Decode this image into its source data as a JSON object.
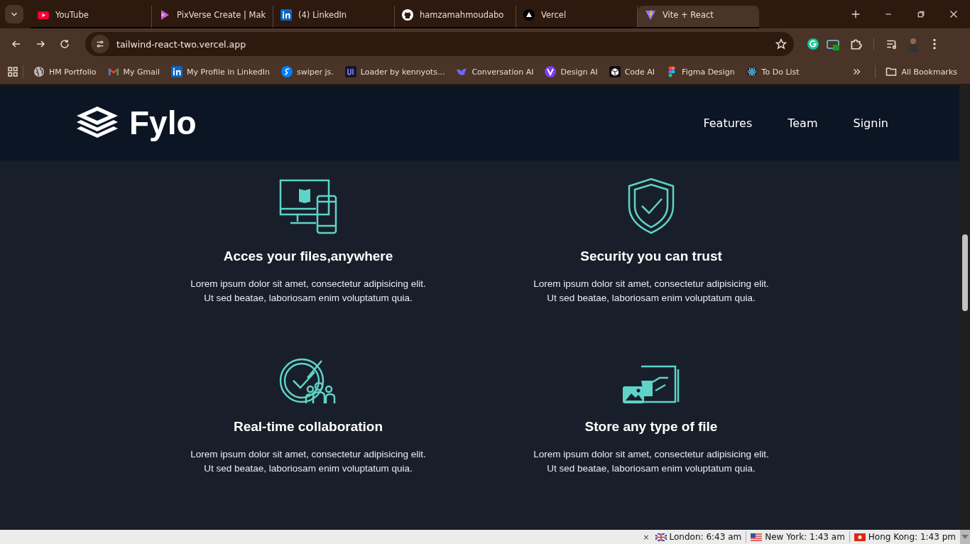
{
  "browser": {
    "tabs": [
      {
        "kind": "youtube",
        "title": "YouTube",
        "selected": false
      },
      {
        "kind": "pixverse",
        "title": "PixVerse Create | Mak",
        "selected": false
      },
      {
        "kind": "linkedin",
        "title": "(4) LinkedIn",
        "selected": false
      },
      {
        "kind": "github",
        "title": "hamzamahmoudabo",
        "selected": false
      },
      {
        "kind": "vercel",
        "title": "Vercel",
        "selected": false
      },
      {
        "kind": "vite",
        "title": "Vite + React",
        "selected": true
      }
    ],
    "address": "tailwind-react-two.vercel.app",
    "bookmarks": [
      {
        "kind": "globe",
        "label": "HM Portfolio"
      },
      {
        "kind": "gmail",
        "label": "My Gmail"
      },
      {
        "kind": "linkedin",
        "label": "My Profile in LinkedIn"
      },
      {
        "kind": "swiper",
        "label": "swiper js."
      },
      {
        "kind": "ui",
        "label": "Loader by kennyots..."
      },
      {
        "kind": "conversation",
        "label": "Conversation AI"
      },
      {
        "kind": "design",
        "label": "Design AI"
      },
      {
        "kind": "code",
        "label": "Code AI"
      },
      {
        "kind": "figma",
        "label": "Figma Design"
      },
      {
        "kind": "react",
        "label": "To Do List"
      }
    ],
    "all_bookmarks": "All Bookmarks"
  },
  "page": {
    "brand": "Fylo",
    "nav": [
      "Features",
      "Team",
      "Signin"
    ],
    "features": [
      {
        "kind": "devices",
        "title": "Acces your files,anywhere",
        "lines": [
          "Lorem ipsum dolor sit amet, consectetur adipisicing elit.",
          "Ut sed beatae, laboriosam enim voluptatum quia."
        ]
      },
      {
        "kind": "shield",
        "title": "Security you can trust",
        "lines": [
          "Lorem ipsum dolor sit amet, consectetur adipisicing elit.",
          "Ut sed beatae, laboriosam enim voluptatum quia."
        ]
      },
      {
        "kind": "team",
        "title": "Real-time collaboration",
        "lines": [
          "Lorem ipsum dolor sit amet, consectetur adipisicing elit.",
          "Ut sed beatae, laboriosam enim voluptatum quia."
        ]
      },
      {
        "kind": "files",
        "title": "Store any type of file",
        "lines": [
          "Lorem ipsum dolor sit amet, consectetur adipisicing elit.",
          "Ut sed beatae, laboriosam enim voluptatum quia."
        ]
      }
    ]
  },
  "clock_bar": {
    "close": "×",
    "clocks": [
      {
        "kind": "uk",
        "label": "London: 6:43 am"
      },
      {
        "kind": "us",
        "label": "New York: 1:43 am"
      },
      {
        "kind": "hk",
        "label": "Hong Kong: 1:43 pm"
      }
    ]
  }
}
